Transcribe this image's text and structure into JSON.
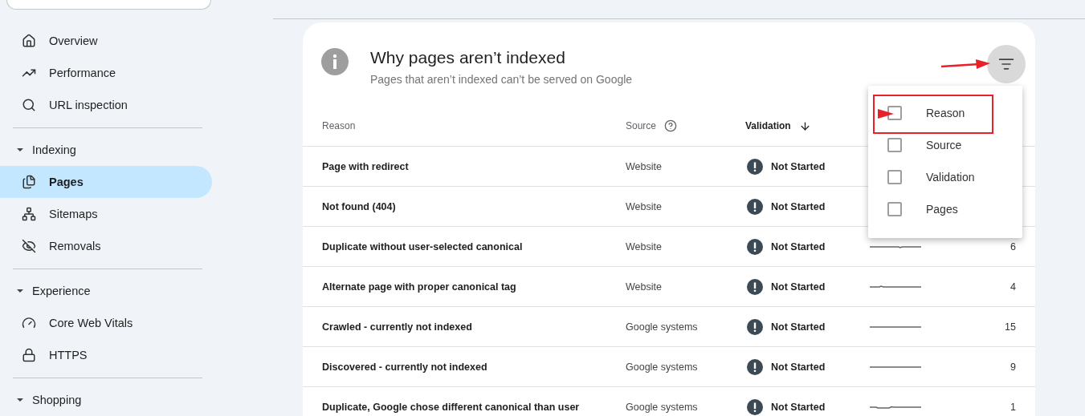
{
  "sidebar": {
    "items": [
      {
        "kind": "link",
        "label": "Overview",
        "selected": false
      },
      {
        "kind": "link",
        "label": "Performance",
        "selected": false
      },
      {
        "kind": "link",
        "label": "URL inspection",
        "selected": false
      },
      {
        "kind": "divider"
      },
      {
        "kind": "section",
        "label": "Indexing",
        "expanded": true
      },
      {
        "kind": "link",
        "label": "Pages",
        "selected": true
      },
      {
        "kind": "link",
        "label": "Sitemaps",
        "selected": false
      },
      {
        "kind": "link",
        "label": "Removals",
        "selected": false
      },
      {
        "kind": "divider"
      },
      {
        "kind": "section",
        "label": "Experience",
        "expanded": true
      },
      {
        "kind": "link",
        "label": "Core Web Vitals",
        "selected": false
      },
      {
        "kind": "link",
        "label": "HTTPS",
        "selected": false
      },
      {
        "kind": "divider"
      },
      {
        "kind": "section",
        "label": "Shopping",
        "expanded": true
      }
    ]
  },
  "card": {
    "title": "Why pages aren’t indexed",
    "subtitle": "Pages that aren’t indexed can’t be served on Google",
    "table": {
      "columns": [
        {
          "label": "Reason",
          "help": false,
          "sorted": false
        },
        {
          "label": "Source",
          "help": true,
          "sorted": false
        },
        {
          "label": "Validation",
          "help": false,
          "sorted": true
        }
      ],
      "rows": [
        {
          "reason": "Page with redirect",
          "source": "Website",
          "validation": "Not Started"
        },
        {
          "reason": "Not found (404)",
          "source": "Website",
          "validation": "Not Started"
        },
        {
          "reason": "Duplicate without user-selected canonical",
          "source": "Website",
          "validation": "Not Started",
          "pages": "6"
        },
        {
          "reason": "Alternate page with proper canonical tag",
          "source": "Website",
          "validation": "Not Started",
          "pages": "4"
        },
        {
          "reason": "Crawled - currently not indexed",
          "source": "Google systems",
          "validation": "Not Started",
          "pages": "15"
        },
        {
          "reason": "Discovered - currently not indexed",
          "source": "Google systems",
          "validation": "Not Started",
          "pages": "9"
        },
        {
          "reason": "Duplicate, Google chose different canonical than user",
          "source": "Google systems",
          "validation": "Not Started",
          "pages": "1"
        }
      ]
    }
  },
  "filter_menu": {
    "open": true,
    "options": [
      {
        "label": "Reason",
        "checked": false
      },
      {
        "label": "Source",
        "checked": false
      },
      {
        "label": "Validation",
        "checked": false
      },
      {
        "label": "Pages",
        "checked": false
      }
    ]
  }
}
